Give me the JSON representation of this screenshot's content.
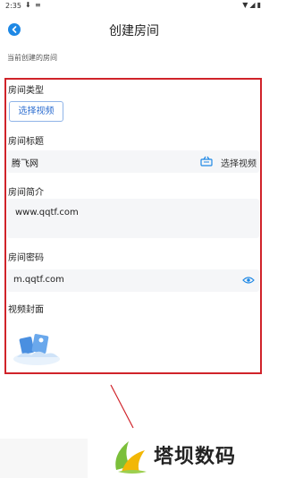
{
  "status_bar": {
    "time": "2:35"
  },
  "nav": {
    "title": "创建房间"
  },
  "current_room_label": "当前创建的房间",
  "form": {
    "room_type": {
      "label": "房间类型",
      "button": "选择视频"
    },
    "room_title": {
      "label": "房间标题",
      "value": "腾飞网",
      "action": "选择视频"
    },
    "room_intro": {
      "label": "房间简介",
      "value": "www.qqtf.com"
    },
    "room_password": {
      "label": "房间密码",
      "value": "m.qqtf.com"
    },
    "video_cover": {
      "label": "视频封面"
    }
  },
  "watermark": {
    "text": "塔坝数码"
  },
  "colors": {
    "accent": "#1e88e5",
    "frame": "#d0232a",
    "field_bg": "#f5f6f8"
  }
}
